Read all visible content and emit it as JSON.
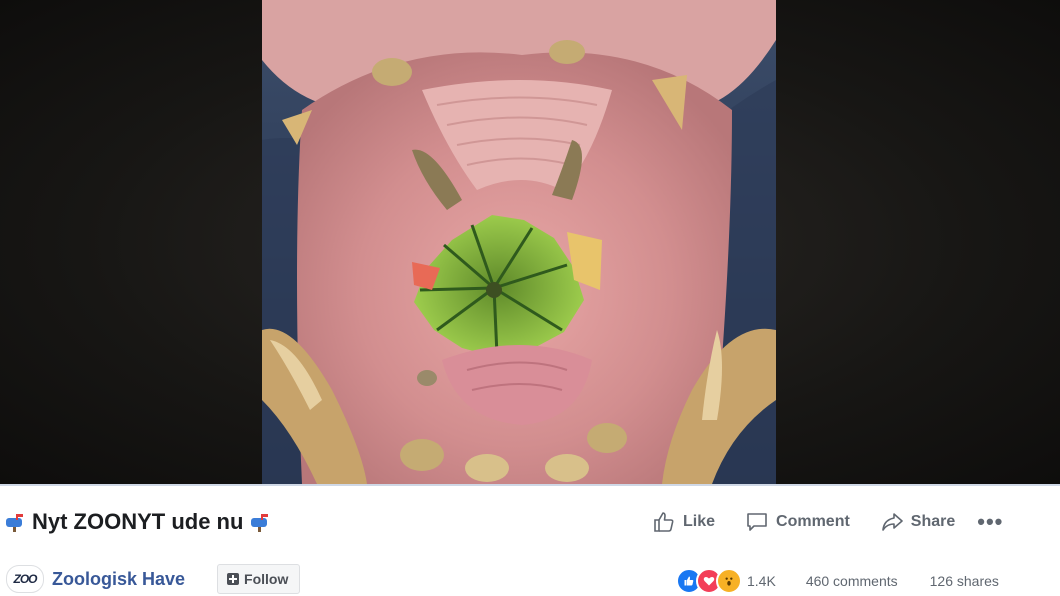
{
  "post": {
    "title": "Nyt ZOONYT ude nu",
    "title_icon": "mailbox-with-mail-emoji"
  },
  "video": {
    "description": "hippo open mouth with watermelon"
  },
  "actions": {
    "like_label": "Like",
    "comment_label": "Comment",
    "share_label": "Share",
    "more_label": "•••"
  },
  "page": {
    "logo_text": "ZOO",
    "name": "Zoologisk Have",
    "follow_label": "Follow"
  },
  "stats": {
    "reactions": [
      "like",
      "love",
      "wow"
    ],
    "reaction_count": "1.4K",
    "comments": "460 comments",
    "shares": "126 shares"
  },
  "colors": {
    "link_blue": "#385898",
    "like_blue": "#1877f2",
    "love_red": "#f33e58",
    "wow_yellow": "#f7b125",
    "text_gray": "#606770"
  }
}
